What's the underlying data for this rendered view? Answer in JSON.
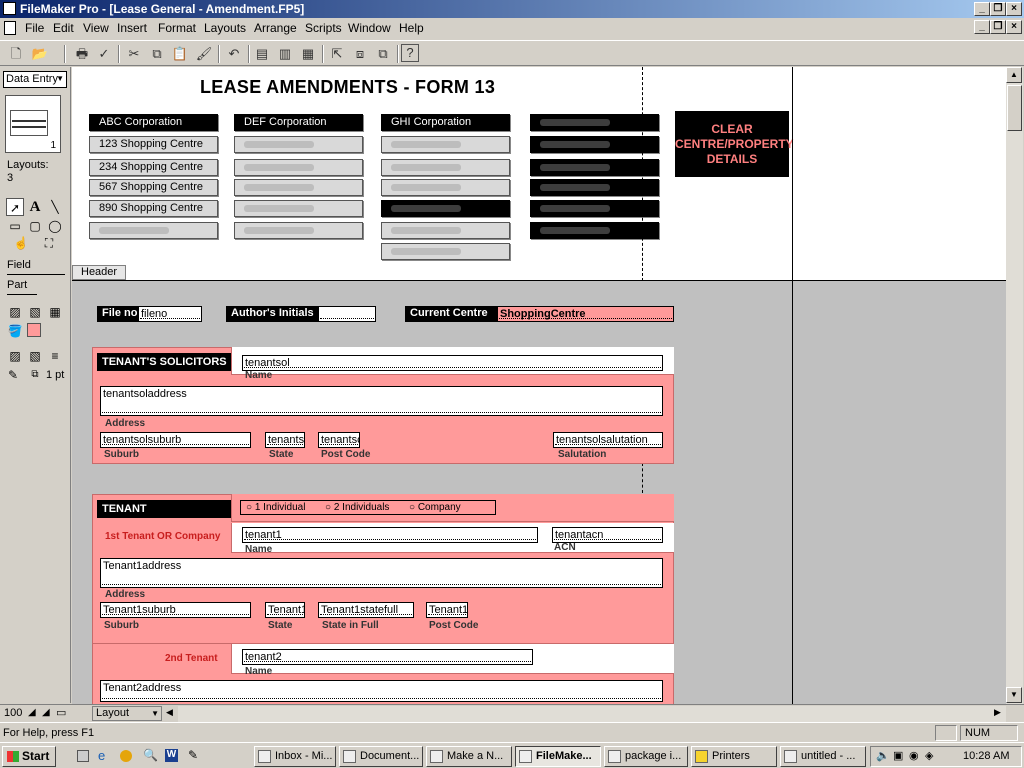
{
  "window": {
    "title": "FileMaker Pro - [Lease General - Amendment.FP5]"
  },
  "menu": [
    "File",
    "Edit",
    "View",
    "Insert",
    "Format",
    "Layouts",
    "Arrange",
    "Scripts",
    "Window",
    "Help"
  ],
  "status_area": {
    "mode": "Data Entry",
    "book_page": "1",
    "layouts_label": "Layouts:",
    "layouts_count": "3",
    "field_tool": "Field",
    "part_tool": "Part",
    "line_width": "1 pt"
  },
  "layout": {
    "title": "LEASE AMENDMENTS - FORM 13",
    "corporations": [
      "ABC Corporation",
      "DEF Corporation",
      "GHI Corporation"
    ],
    "centres": [
      "123 Shopping Centre",
      "234 Shopping Centre",
      "567 Shopping Centre",
      "890 Shopping Centre"
    ],
    "clear_button": "CLEAR CENTRE/PROPERTY DETAILS",
    "header_part_label": "Header",
    "file_no_label": "File no",
    "file_no_field": "fileno",
    "authors_initials_label": "Author's Initials",
    "current_centre_label": "Current Centre",
    "current_centre_field": "ShoppingCentre",
    "solicitors": {
      "heading": "TENANT'S SOLICITORS",
      "name_field": "tenantsol",
      "name_caption": "Name",
      "address_field": "tenantsoladdress",
      "address_caption": "Address",
      "suburb_field": "tenantsolsuburb",
      "suburb_caption": "Suburb",
      "state_field": "tenantsc",
      "state_caption": "State",
      "postcode_field": "tenantsc",
      "postcode_caption": "Post Code",
      "salutation_field": "tenantsolsalutation",
      "salutation_caption": "Salutation"
    },
    "tenant": {
      "heading": "TENANT",
      "options": [
        "1 Individual",
        "2 Individuals",
        "Company"
      ],
      "first_label": "1st Tenant OR Company",
      "tenant1_field": "tenant1",
      "name_caption": "Name",
      "acn_field": "tenantacn",
      "acn_caption": "ACN",
      "address_field": "Tenant1address",
      "address_caption": "Address",
      "suburb_field": "Tenant1suburb",
      "suburb_caption": "Suburb",
      "state_field": "Tenant1",
      "state_caption": "State",
      "statefull_field": "Tenant1statefull",
      "statefull_caption": "State in Full",
      "postcode_field": "Tenant1",
      "postcode_caption": "Post Code",
      "second_label": "2nd Tenant",
      "tenant2_field": "tenant2",
      "name2_caption": "Name",
      "address2_field": "Tenant2address"
    }
  },
  "bottom_bar": {
    "zoom": "100",
    "mode_select": "Layout"
  },
  "statusbar": {
    "help": "For Help, press F1",
    "num": "NUM"
  },
  "taskbar": {
    "start": "Start",
    "tasks": [
      "Inbox - Mi...",
      "Document...",
      "Make a N...",
      "FileMake...",
      "package i...",
      "Printers",
      "untitled - ..."
    ],
    "clock": "10:28 AM"
  }
}
